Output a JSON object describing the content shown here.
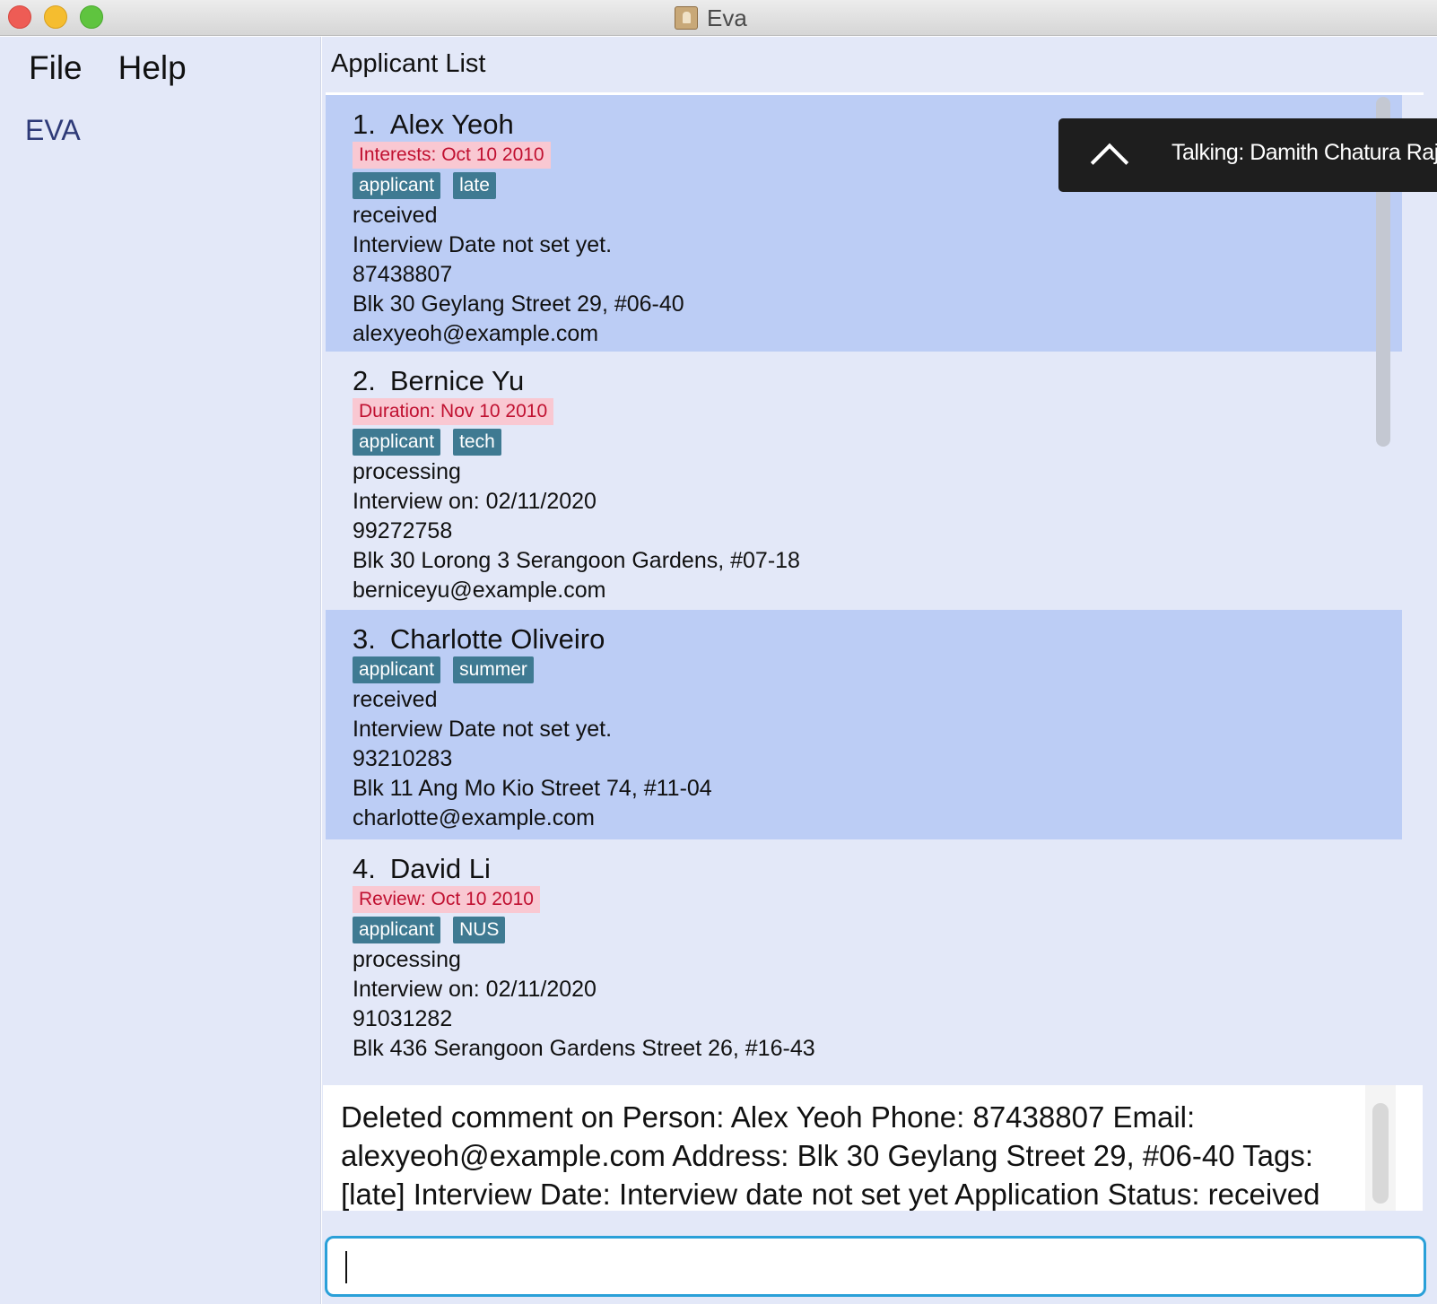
{
  "window": {
    "title": "Eva"
  },
  "menu": {
    "file": "File",
    "help": "Help"
  },
  "sidebar": {
    "brand": "EVA"
  },
  "list": {
    "header": "Applicant List",
    "cards": [
      {
        "index": "1.",
        "name": "Alex Yeoh",
        "date_tag": "Interests: Oct 10 2010",
        "tags": [
          "applicant",
          "late"
        ],
        "status": "received",
        "interview": "Interview Date not set yet.",
        "phone": "87438807",
        "address": "Blk 30 Geylang Street 29, #06-40",
        "email": "alexyeoh@example.com"
      },
      {
        "index": "2.",
        "name": "Bernice Yu",
        "date_tag": "Duration: Nov 10 2010",
        "tags": [
          "applicant",
          "tech"
        ],
        "status": "processing",
        "interview": "Interview on: 02/11/2020",
        "phone": "99272758",
        "address": "Blk 30 Lorong 3 Serangoon Gardens, #07-18",
        "email": "berniceyu@example.com"
      },
      {
        "index": "3.",
        "name": "Charlotte Oliveiro",
        "tags": [
          "applicant",
          "summer"
        ],
        "status": "received",
        "interview": "Interview Date not set yet.",
        "phone": "93210283",
        "address": "Blk 11 Ang Mo Kio Street 74, #11-04",
        "email": "charlotte@example.com"
      },
      {
        "index": "4.",
        "name": "David Li",
        "date_tag": "Review: Oct 10 2010",
        "tags": [
          "applicant",
          "NUS"
        ],
        "status": "processing",
        "interview": "Interview on: 02/11/2020",
        "phone": "91031282",
        "address": "Blk 436 Serangoon Gardens Street 26, #16-43"
      }
    ]
  },
  "toast": {
    "text": "Talking: Damith Chatura Raj"
  },
  "result": {
    "text": "Deleted comment on Person: Alex Yeoh Phone: 87438807 Email: alexyeoh@example.com Address: Blk 30 Geylang Street 29, #06-40 Tags: [late] Interview Date: Interview date not set yet Application Status: received"
  },
  "command": {
    "value": ""
  }
}
